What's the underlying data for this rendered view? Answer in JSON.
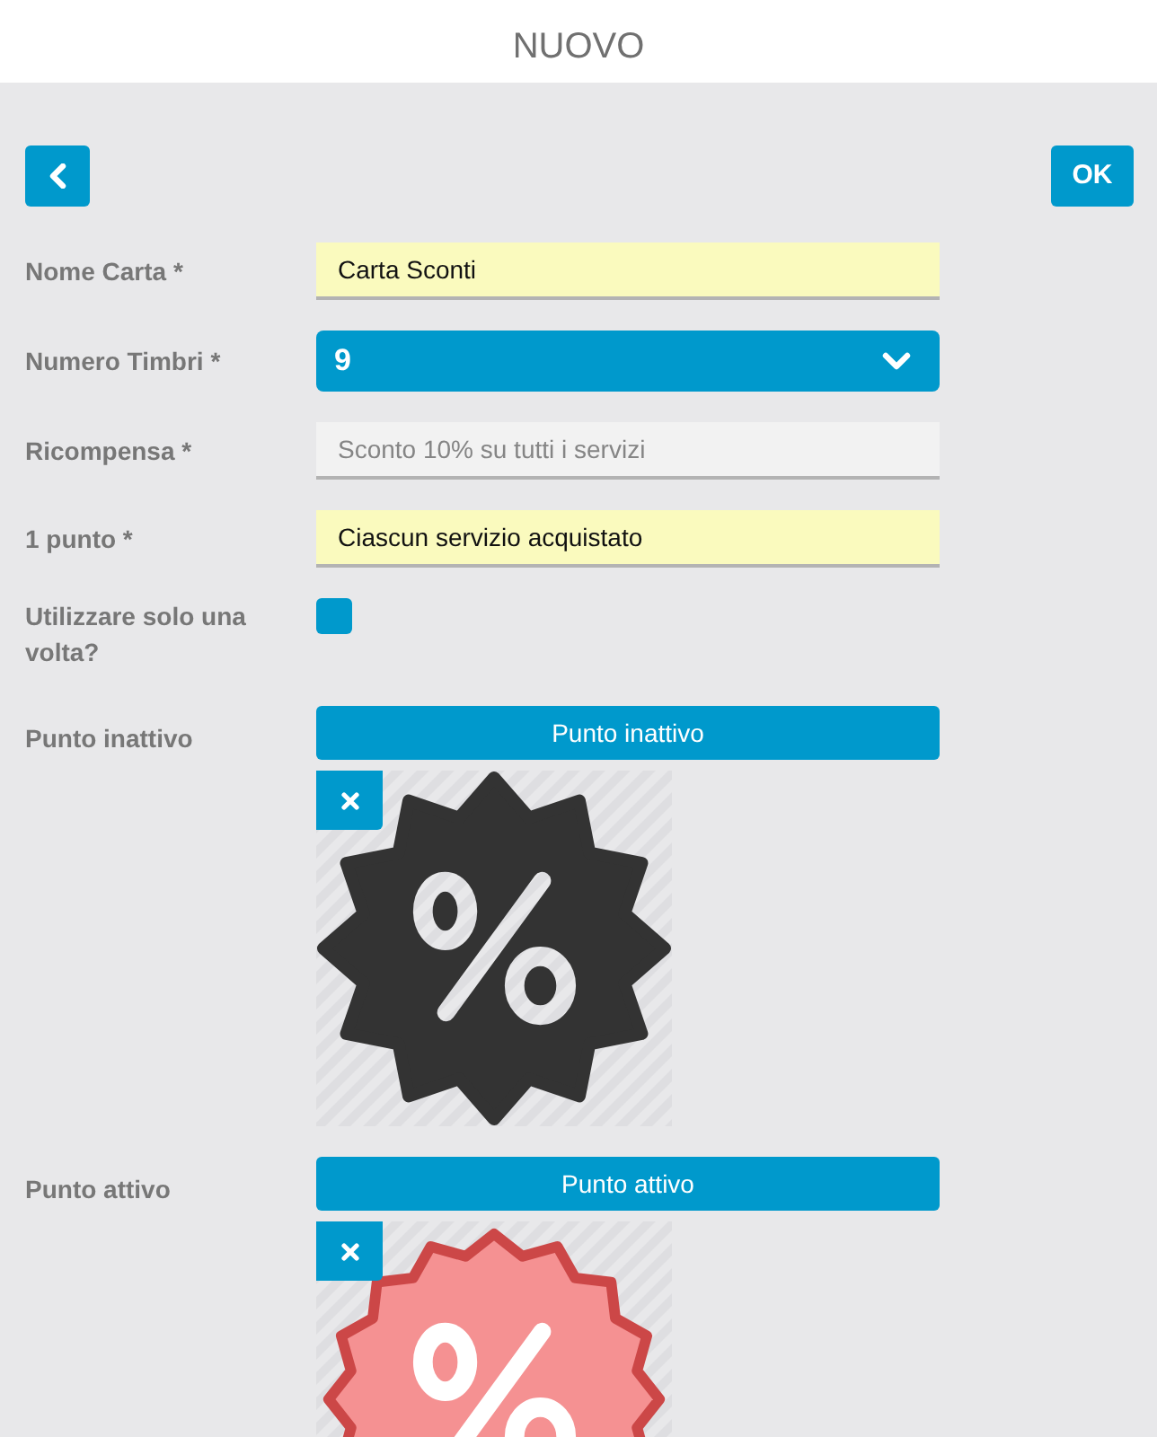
{
  "header": {
    "title": "NUOVO"
  },
  "toolbar": {
    "ok_button": "OK"
  },
  "fields": [
    {
      "kind": "text",
      "label": "Nome Carta *",
      "value": "Carta Sconti"
    },
    {
      "kind": "select",
      "label": "Numero Timbri *",
      "value": "9"
    },
    {
      "kind": "text",
      "label": "Ricompensa *",
      "placeholder": "Sconto 10% su tutti i servizi"
    },
    {
      "kind": "text",
      "label": "1 punto *",
      "value": "Ciascun servizio acquistato"
    },
    {
      "kind": "checkbox",
      "label": "Utilizzare solo una volta?",
      "checked": false
    },
    {
      "kind": "image",
      "label": "Punto inattivo",
      "button": "Punto inattivo",
      "image": {
        "kind": "star",
        "color": "#333333"
      }
    },
    {
      "kind": "image",
      "label": "Punto attivo",
      "button": "Punto attivo",
      "image": {
        "kind": "seal",
        "color": "#f59192"
      }
    }
  ]
}
